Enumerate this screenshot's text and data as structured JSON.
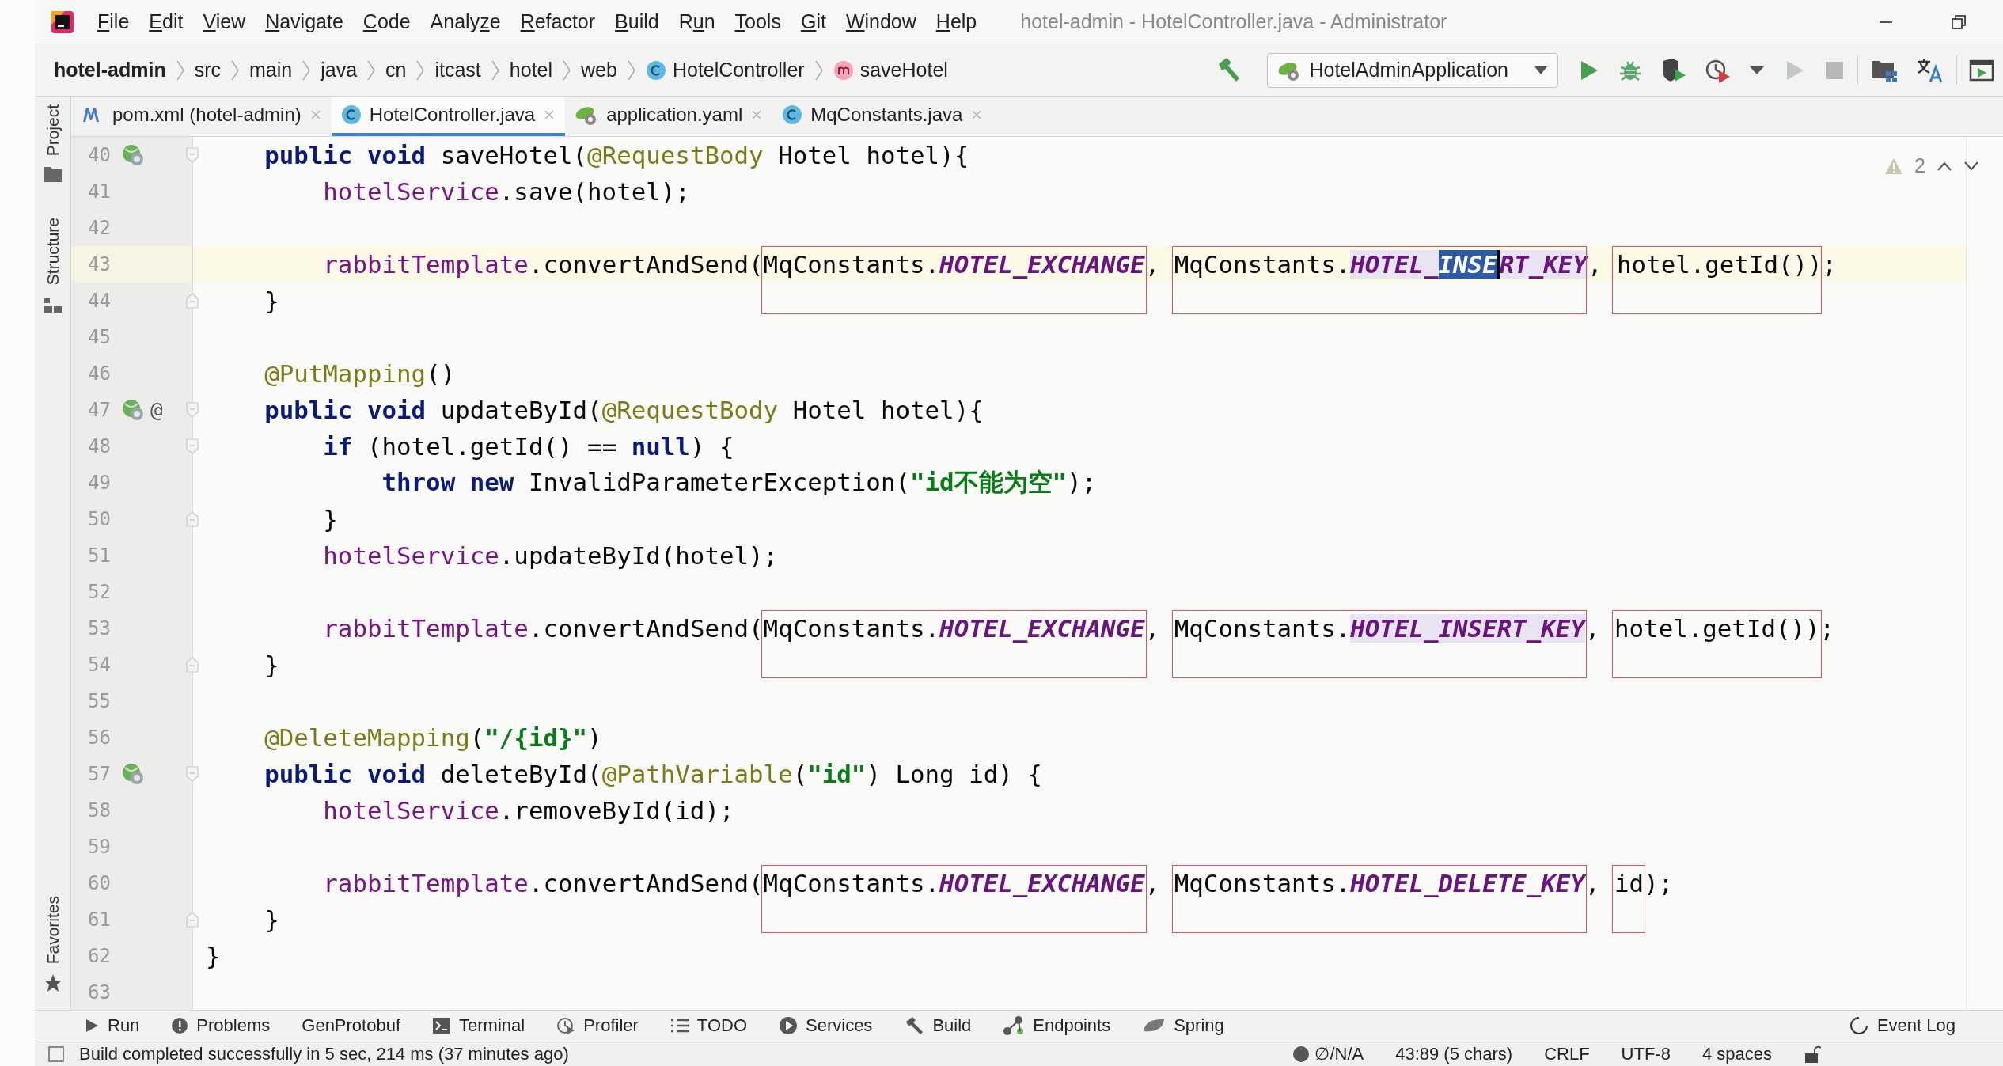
{
  "window": {
    "title": "hotel-admin - HotelController.java - Administrator"
  },
  "menu": [
    {
      "key": "F",
      "post": "ile"
    },
    {
      "key": "E",
      "post": "dit"
    },
    {
      "key": "V",
      "post": "iew"
    },
    {
      "key": "N",
      "post": "avigate"
    },
    {
      "key": "C",
      "post": "ode"
    },
    {
      "pre": "Analy",
      "key": "z",
      "post": "e"
    },
    {
      "key": "R",
      "post": "efactor"
    },
    {
      "key": "B",
      "post": "uild"
    },
    {
      "pre": "R",
      "key": "u",
      "post": "n"
    },
    {
      "key": "T",
      "post": "ools"
    },
    {
      "key": "G",
      "post": "it"
    },
    {
      "key": "W",
      "post": "indow"
    },
    {
      "key": "H",
      "post": "elp"
    }
  ],
  "breadcrumbs": [
    {
      "label": "hotel-admin",
      "kind": "project"
    },
    {
      "label": "src",
      "kind": "folder"
    },
    {
      "label": "main",
      "kind": "folder"
    },
    {
      "label": "java",
      "kind": "folder"
    },
    {
      "label": "cn",
      "kind": "folder"
    },
    {
      "label": "itcast",
      "kind": "folder"
    },
    {
      "label": "hotel",
      "kind": "folder"
    },
    {
      "label": "web",
      "kind": "folder"
    },
    {
      "label": "HotelController",
      "kind": "class"
    },
    {
      "label": "saveHotel",
      "kind": "method"
    }
  ],
  "run_config": {
    "label": "HotelAdminApplication"
  },
  "toolbar": [
    {
      "kind": "run",
      "disabled": false
    },
    {
      "kind": "debug",
      "disabled": false
    },
    {
      "kind": "coverage",
      "disabled": false
    },
    {
      "kind": "profile",
      "disabled": false
    },
    {
      "kind": "more",
      "disabled": false
    },
    {
      "kind": "resume",
      "disabled": true
    },
    {
      "kind": "stop",
      "disabled": true
    },
    {
      "kind": "structure",
      "disabled": false
    },
    {
      "kind": "translate",
      "disabled": false
    },
    {
      "kind": "preview",
      "disabled": false
    }
  ],
  "left_tools": [
    {
      "label": "Project",
      "kind": "project"
    },
    {
      "label": "Structure",
      "kind": "structure"
    }
  ],
  "left_tools_bottom": [
    {
      "label": "Favorites",
      "kind": "favorites"
    }
  ],
  "tabs": [
    {
      "label": "pom.xml (hotel-admin)",
      "kind": "maven",
      "selected": false
    },
    {
      "label": "HotelController.java",
      "kind": "class",
      "selected": true
    },
    {
      "label": "application.yaml",
      "kind": "yaml",
      "selected": false
    },
    {
      "label": "MqConstants.java",
      "kind": "class",
      "selected": false
    }
  ],
  "inspections": {
    "count": "2"
  },
  "editor": {
    "lines": [
      {
        "number": "40",
        "endpoint_icon": true,
        "fold_start": true,
        "fold_end": false,
        "current": false,
        "segments": [
          {
            "text": "    public void ",
            "kind": "keyword"
          },
          {
            "text": "saveHotel(",
            "kind": "plain"
          },
          {
            "text": "@RequestBody",
            "kind": "annotation"
          },
          {
            "text": " Hotel hotel){",
            "kind": "plain"
          }
        ]
      },
      {
        "number": "41",
        "endpoint_icon": false,
        "fold_start": false,
        "fold_end": false,
        "current": false,
        "segments": [
          {
            "text": "        hotelService",
            "kind": "field"
          },
          {
            "text": ".save(hotel);",
            "kind": "plain"
          }
        ]
      },
      {
        "number": "42",
        "endpoint_icon": false,
        "fold_start": false,
        "fold_end": false,
        "current": false
      },
      {
        "number": "43",
        "endpoint_icon": false,
        "fold_start": false,
        "fold_end": false,
        "current": true,
        "segments": [
          {
            "text": "        rabbitTemplate",
            "kind": "field"
          },
          {
            "text": ".convertAndSend(",
            "kind": "plain"
          },
          {
            "kind": "box",
            "segments": [
              {
                "text": "MqConstants.",
                "kind": "plain"
              },
              {
                "text": "HOTEL_EXCHANGE",
                "kind": "constant"
              }
            ]
          },
          {
            "text": ", ",
            "kind": "plain"
          },
          {
            "kind": "box",
            "segments": [
              {
                "text": "MqConstants.",
                "kind": "plain"
              },
              {
                "text": "HOTEL_",
                "kind": "usage"
              },
              {
                "text": "INSE",
                "kind": "selection",
                "caret": true
              },
              {
                "text": "RT_KEY",
                "kind": "usage"
              }
            ]
          },
          {
            "text": ", ",
            "kind": "plain"
          },
          {
            "kind": "box",
            "segments": [
              {
                "text": "hotel.getId())",
                "kind": "plain"
              }
            ]
          },
          {
            "text": ";",
            "kind": "plain"
          }
        ]
      },
      {
        "number": "44",
        "endpoint_icon": false,
        "fold_start": false,
        "fold_end": true,
        "current": false,
        "segments": [
          {
            "text": "    }",
            "kind": "plain"
          }
        ]
      },
      {
        "number": "45",
        "endpoint_icon": false,
        "fold_start": false,
        "fold_end": false,
        "current": false
      },
      {
        "number": "46",
        "endpoint_icon": false,
        "fold_start": false,
        "fold_end": false,
        "current": false,
        "segments": [
          {
            "text": "    @PutMapping",
            "kind": "annotation"
          },
          {
            "text": "()",
            "kind": "plain"
          }
        ]
      },
      {
        "number": "47",
        "endpoint_icon": true,
        "marker": "@",
        "fold_start": true,
        "fold_end": false,
        "current": false,
        "segments": [
          {
            "text": "    public void ",
            "kind": "keyword"
          },
          {
            "text": "updateById(",
            "kind": "plain"
          },
          {
            "text": "@RequestBody",
            "kind": "annotation"
          },
          {
            "text": " Hotel hotel){",
            "kind": "plain"
          }
        ]
      },
      {
        "number": "48",
        "endpoint_icon": false,
        "fold_start": true,
        "fold_end": false,
        "current": false,
        "segments": [
          {
            "text": "        if ",
            "kind": "keyword"
          },
          {
            "text": "(hotel.getId() == ",
            "kind": "plain"
          },
          {
            "text": "null",
            "kind": "keyword"
          },
          {
            "text": ") {",
            "kind": "plain"
          }
        ]
      },
      {
        "number": "49",
        "endpoint_icon": false,
        "fold_start": false,
        "fold_end": false,
        "current": false,
        "segments": [
          {
            "text": "            throw new ",
            "kind": "keyword"
          },
          {
            "text": "InvalidParameterException(",
            "kind": "plain"
          },
          {
            "text": "\"id不能为空\"",
            "kind": "string"
          },
          {
            "text": ");",
            "kind": "plain"
          }
        ]
      },
      {
        "number": "50",
        "endpoint_icon": false,
        "fold_start": false,
        "fold_end": true,
        "current": false,
        "segments": [
          {
            "text": "        }",
            "kind": "plain"
          }
        ]
      },
      {
        "number": "51",
        "endpoint_icon": false,
        "fold_start": false,
        "fold_end": false,
        "current": false,
        "segments": [
          {
            "text": "        hotelService",
            "kind": "field"
          },
          {
            "text": ".updateById(hotel);",
            "kind": "plain"
          }
        ]
      },
      {
        "number": "52",
        "endpoint_icon": false,
        "fold_start": false,
        "fold_end": false,
        "current": false
      },
      {
        "number": "53",
        "endpoint_icon": false,
        "fold_start": false,
        "fold_end": false,
        "current": false,
        "segments": [
          {
            "text": "        rabbitTemplate",
            "kind": "field"
          },
          {
            "text": ".convertAndSend(",
            "kind": "plain"
          },
          {
            "kind": "box",
            "segments": [
              {
                "text": "MqConstants.",
                "kind": "plain"
              },
              {
                "text": "HOTEL_EXCHANGE",
                "kind": "constant"
              }
            ]
          },
          {
            "text": ", ",
            "kind": "plain"
          },
          {
            "kind": "box",
            "segments": [
              {
                "text": "MqConstants.",
                "kind": "plain"
              },
              {
                "text": "HOTEL_INSERT_KEY",
                "kind": "usage"
              }
            ]
          },
          {
            "text": ", ",
            "kind": "plain"
          },
          {
            "kind": "box",
            "segments": [
              {
                "text": "hotel.getId())",
                "kind": "plain"
              }
            ]
          },
          {
            "text": ";",
            "kind": "plain"
          }
        ]
      },
      {
        "number": "54",
        "endpoint_icon": false,
        "fold_start": false,
        "fold_end": true,
        "current": false,
        "segments": [
          {
            "text": "    }",
            "kind": "plain"
          }
        ]
      },
      {
        "number": "55",
        "endpoint_icon": false,
        "fold_start": false,
        "fold_end": false,
        "current": false
      },
      {
        "number": "56",
        "endpoint_icon": false,
        "fold_start": false,
        "fold_end": false,
        "current": false,
        "segments": [
          {
            "text": "    @DeleteMapping",
            "kind": "annotation"
          },
          {
            "text": "(",
            "kind": "plain"
          },
          {
            "text": "\"/{id}\"",
            "kind": "string"
          },
          {
            "text": ")",
            "kind": "plain"
          }
        ]
      },
      {
        "number": "57",
        "endpoint_icon": true,
        "fold_start": true,
        "fold_end": false,
        "current": false,
        "segments": [
          {
            "text": "    public void ",
            "kind": "keyword"
          },
          {
            "text": "deleteById(",
            "kind": "plain"
          },
          {
            "text": "@PathVariable",
            "kind": "annotation"
          },
          {
            "text": "(",
            "kind": "plain"
          },
          {
            "text": "\"id\"",
            "kind": "string"
          },
          {
            "text": ") Long id) {",
            "kind": "plain"
          }
        ]
      },
      {
        "number": "58",
        "endpoint_icon": false,
        "fold_start": false,
        "fold_end": false,
        "current": false,
        "segments": [
          {
            "text": "        hotelService",
            "kind": "field"
          },
          {
            "text": ".removeById(id);",
            "kind": "plain"
          }
        ]
      },
      {
        "number": "59",
        "endpoint_icon": false,
        "fold_start": false,
        "fold_end": false,
        "current": false
      },
      {
        "number": "60",
        "endpoint_icon": false,
        "fold_start": false,
        "fold_end": false,
        "current": false,
        "segments": [
          {
            "text": "        rabbitTemplate",
            "kind": "field"
          },
          {
            "text": ".convertAndSend(",
            "kind": "plain"
          },
          {
            "kind": "box",
            "segments": [
              {
                "text": "MqConstants.",
                "kind": "plain"
              },
              {
                "text": "HOTEL_EXCHANGE",
                "kind": "constant"
              }
            ]
          },
          {
            "text": ", ",
            "kind": "plain"
          },
          {
            "kind": "box",
            "segments": [
              {
                "text": "MqConstants.",
                "kind": "plain"
              },
              {
                "text": "HOTEL_DELETE_KEY",
                "kind": "constant"
              }
            ]
          },
          {
            "text": ", ",
            "kind": "plain"
          },
          {
            "kind": "box",
            "segments": [
              {
                "text": "id",
                "kind": "plain"
              }
            ]
          },
          {
            "text": ");",
            "kind": "plain"
          }
        ]
      },
      {
        "number": "61",
        "endpoint_icon": false,
        "fold_start": false,
        "fold_end": true,
        "current": false,
        "segments": [
          {
            "text": "    }",
            "kind": "plain"
          }
        ]
      },
      {
        "number": "62",
        "endpoint_icon": false,
        "fold_start": false,
        "fold_end": false,
        "current": false,
        "segments": [
          {
            "text": "}",
            "kind": "plain"
          }
        ]
      },
      {
        "number": "63",
        "endpoint_icon": false,
        "fold_start": false,
        "fold_end": false,
        "current": false
      }
    ]
  },
  "bottom_tools": [
    {
      "label": "Run",
      "kind": "run"
    },
    {
      "label": "Problems",
      "kind": "problems"
    },
    {
      "label": "GenProtobuf",
      "kind": "none"
    },
    {
      "label": "Terminal",
      "kind": "terminal"
    },
    {
      "label": "Profiler",
      "kind": "profiler"
    },
    {
      "label": "TODO",
      "kind": "todo"
    },
    {
      "label": "Services",
      "kind": "services"
    },
    {
      "label": "Build",
      "kind": "build"
    },
    {
      "label": "Endpoints",
      "kind": "endpoints"
    },
    {
      "label": "Spring",
      "kind": "spring"
    }
  ],
  "event_log": {
    "label": "Event Log"
  },
  "status": {
    "message": "Build completed successfully in 5 sec, 214 ms (37 minutes ago)",
    "items": [
      {
        "label": "∅/N/A",
        "kind": "dot"
      },
      {
        "label": "43:89 (5 chars)",
        "kind": "text"
      },
      {
        "label": "CRLF",
        "kind": "text"
      },
      {
        "label": "UTF-8",
        "kind": "text"
      },
      {
        "label": "4 spaces",
        "kind": "text"
      },
      {
        "kind": "lock"
      }
    ]
  }
}
